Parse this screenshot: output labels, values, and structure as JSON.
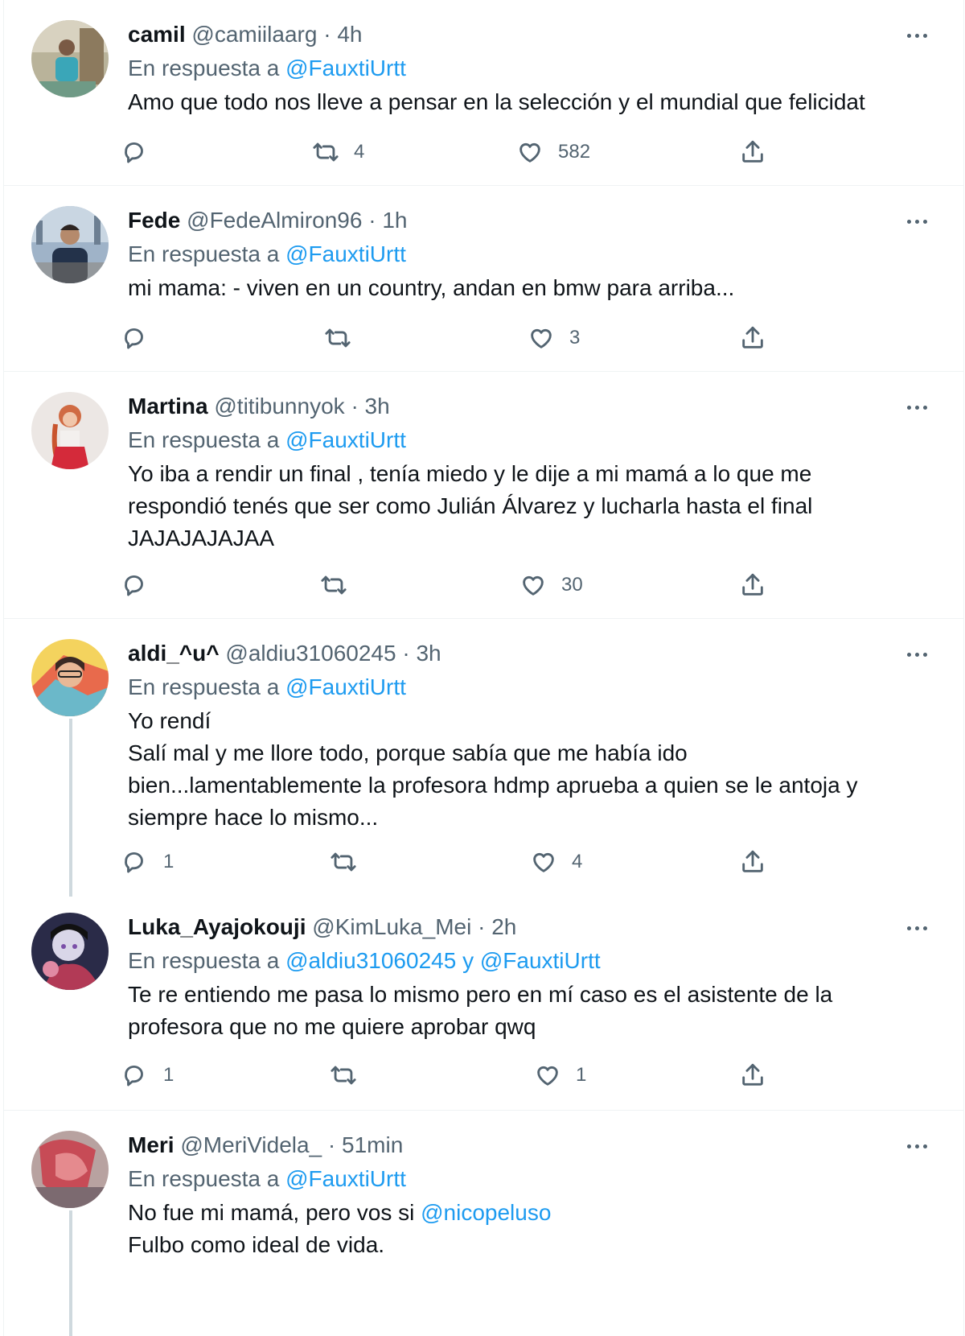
{
  "tweets": [
    {
      "name": "camil",
      "handle": "@camiilaarg",
      "time": "4h",
      "reply_prefix": "En respuesta a",
      "reply_to": "@FauxtiUrtt",
      "lines": [
        "Amo que todo nos lleve a pensar en la selección y el mundial que felicidat"
      ],
      "reply_count": "",
      "retweet_count": "4",
      "like_count": "582"
    },
    {
      "name": "Fede",
      "handle": "@FedeAlmiron96",
      "time": "1h",
      "reply_prefix": "En respuesta a",
      "reply_to": "@FauxtiUrtt",
      "lines": [
        "mi mama: - viven en un country, andan en bmw para arriba..."
      ],
      "reply_count": "",
      "retweet_count": "",
      "like_count": "3"
    },
    {
      "name": "Martina",
      "handle": "@titibunnyok",
      "time": "3h",
      "reply_prefix": "En respuesta a",
      "reply_to": "@FauxtiUrtt",
      "lines": [
        "Yo iba a rendir un final , tenía miedo y le dije a mi mamá a lo que me",
        "respondió tenés que ser como Julián Álvarez y lucharla hasta el final",
        "JAJAJAJAJAA"
      ],
      "reply_count": "",
      "retweet_count": "",
      "like_count": "30"
    },
    {
      "name": "aldi_^u^",
      "handle": "@aldiu31060245",
      "time": "3h",
      "reply_prefix": "En respuesta a",
      "reply_to": "@FauxtiUrtt",
      "lines": [
        "Yo rendí",
        "Salí mal  y me llore todo, porque sabía que me había ido",
        "bien...lamentablemente la profesora hdmp aprueba a quien se le antoja y",
        "siempre hace lo mismo..."
      ],
      "reply_count": "1",
      "retweet_count": "",
      "like_count": "4"
    },
    {
      "name": "Luka_Ayajokouji",
      "handle": "@KimLuka_Mei",
      "time": "2h",
      "reply_prefix": "En respuesta a",
      "reply_to": "@aldiu31060245",
      "reply_join": "y",
      "reply_to_2": "@FauxtiUrtt",
      "lines": [
        "Te re entiendo me pasa lo mismo pero en mí caso es el asistente de la",
        "profesora que no me quiere aprobar qwq"
      ],
      "reply_count": "1",
      "retweet_count": "",
      "like_count": "1"
    },
    {
      "name": "Meri",
      "handle": "@MeriVidela_",
      "time": "51min",
      "reply_prefix": "En respuesta a",
      "reply_to": "@FauxtiUrtt",
      "lines_prefix": "No fue mi mamá, pero vos si",
      "line_mention": "@nicopeluso",
      "lines": [
        "Fulbo como ideal de vida."
      ]
    }
  ],
  "separator": "·",
  "icons": [
    "more-icon",
    "reply-icon",
    "retweet-icon",
    "like-icon",
    "share-icon"
  ],
  "colors": {
    "text": "#0f1419",
    "secondary": "#536471",
    "link": "#1d9bf0",
    "border": "#eff3f4",
    "thread": "#cfd9de"
  }
}
